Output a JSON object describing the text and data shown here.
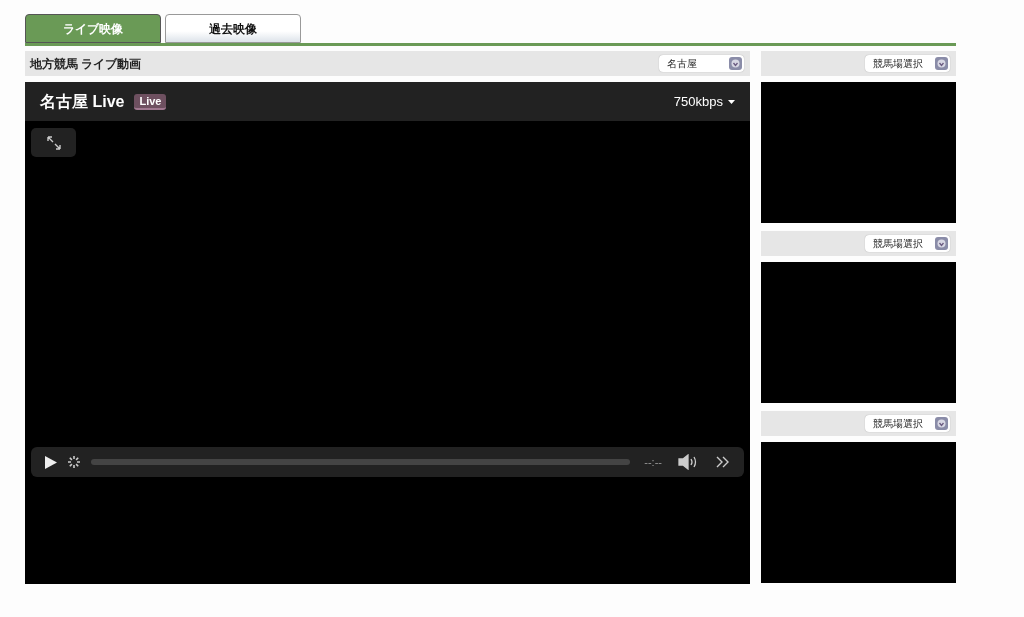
{
  "tabs": [
    {
      "label": "ライブ映像",
      "selected": true
    },
    {
      "label": "過去映像",
      "selected": false
    }
  ],
  "main": {
    "title": "地方競馬 ライブ動画",
    "venue_select": "名古屋",
    "player": {
      "title": "名古屋 Live",
      "badge": "Live",
      "bitrate": "750kbps",
      "time": "--:--"
    }
  },
  "side_panels": [
    {
      "select": "競馬場選択"
    },
    {
      "select": "競馬場選択"
    },
    {
      "select": "競馬場選択"
    }
  ]
}
